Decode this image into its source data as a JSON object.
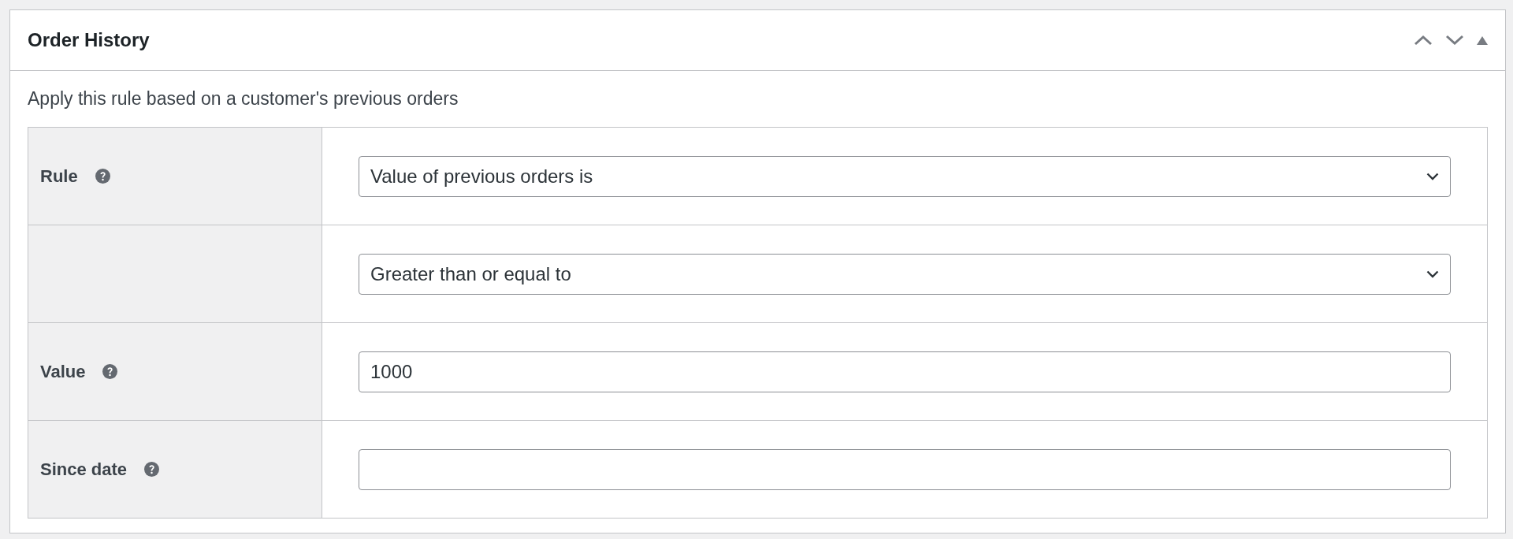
{
  "panel": {
    "title": "Order History",
    "controls": [
      {
        "kind": "up"
      },
      {
        "kind": "down"
      },
      {
        "kind": "toggle"
      }
    ]
  },
  "description": "Apply this rule based on a customer's previous orders",
  "rows": [
    {
      "label": "Rule",
      "help": true,
      "field": {
        "kind": "select",
        "value": "Value of previous orders is"
      }
    },
    {
      "help": false,
      "field": {
        "kind": "select",
        "value": "Greater than or equal to"
      }
    },
    {
      "label": "Value",
      "help": true,
      "field": {
        "kind": "input",
        "value": "1000"
      }
    },
    {
      "label": "Since date",
      "help": true,
      "field": {
        "kind": "input"
      }
    }
  ]
}
